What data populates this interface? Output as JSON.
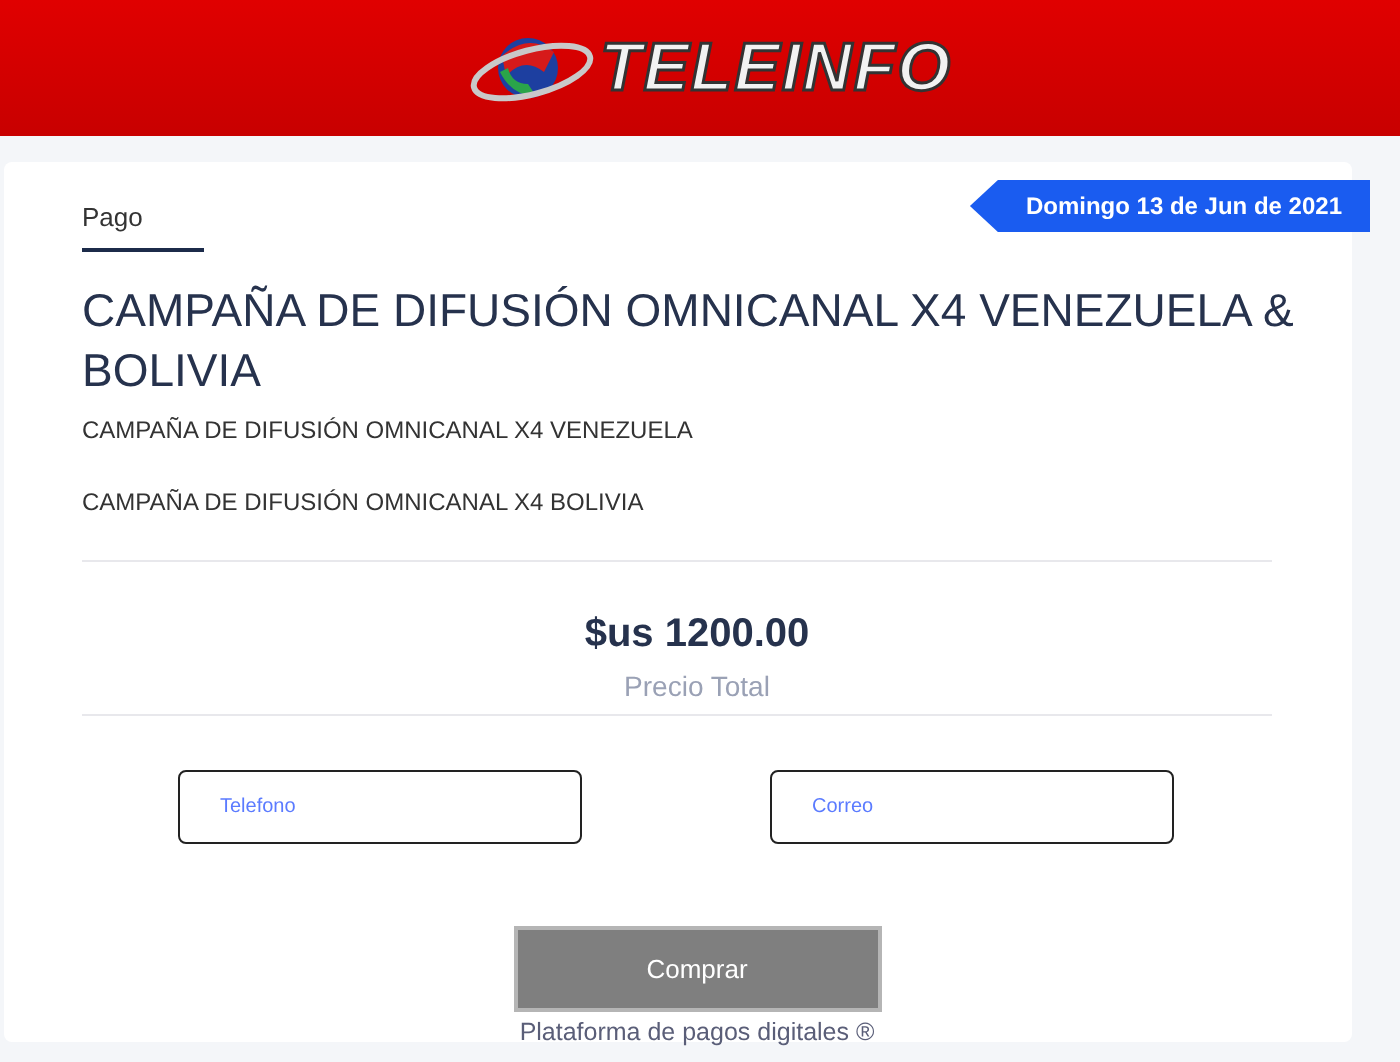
{
  "header": {
    "logo_text": "TELEINFO"
  },
  "date_ribbon": "Domingo 13 de Jun de 2021",
  "tabs": [
    {
      "label": "Pago",
      "selected": true
    }
  ],
  "title": "CAMPAÑA DE DIFUSIÓN OMNICANAL X4 VENEZUELA & BOLIVIA",
  "items": [
    "CAMPAÑA DE DIFUSIÓN OMNICANAL X4 VENEZUELA",
    "CAMPAÑA DE DIFUSIÓN OMNICANAL X4 BOLIVIA"
  ],
  "price": {
    "amount": "$us 1200.00",
    "label": "Precio Total"
  },
  "fields": [
    {
      "placeholder": "Telefono"
    },
    {
      "placeholder": "Correo"
    }
  ],
  "buy_button": "Comprar",
  "footer": "Plataforma de pagos digitales ®"
}
